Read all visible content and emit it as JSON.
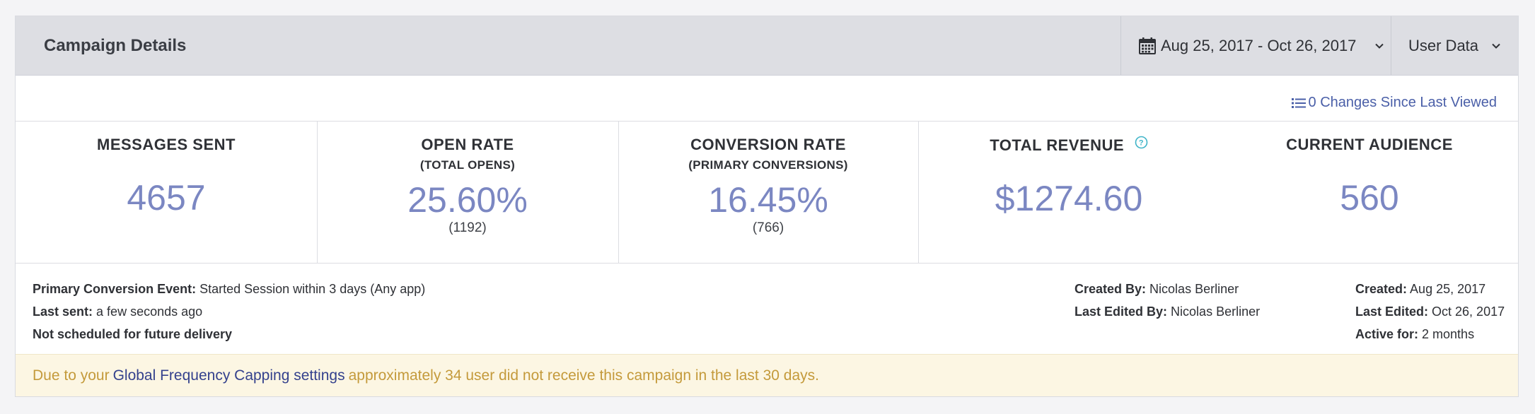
{
  "header": {
    "title": "Campaign Details",
    "date_range": "Aug 25, 2017 - Oct 26, 2017",
    "data_menu": "User Data"
  },
  "changes_link": "0 Changes Since Last Viewed",
  "stats": {
    "messages_sent": {
      "label": "MESSAGES SENT",
      "value": "4657"
    },
    "open_rate": {
      "label": "OPEN RATE",
      "sub": "(TOTAL OPENS)",
      "value": "25.60%",
      "count": "(1192)"
    },
    "conversion_rate": {
      "label": "CONVERSION RATE",
      "sub": "(PRIMARY CONVERSIONS)",
      "value": "16.45%",
      "count": "(766)"
    },
    "total_revenue": {
      "label": "TOTAL REVENUE",
      "value": "$1274.60"
    },
    "current_audience": {
      "label": "CURRENT AUDIENCE",
      "value": "560"
    }
  },
  "details": {
    "primary_conversion_label": "Primary Conversion Event:",
    "primary_conversion_value": "Started Session within 3 days (Any app)",
    "last_sent_label": "Last sent:",
    "last_sent_value": "a few seconds ago",
    "schedule_note": "Not scheduled for future delivery",
    "created_by_label": "Created By:",
    "created_by_value": "Nicolas Berliner",
    "last_edited_by_label": "Last Edited By:",
    "last_edited_by_value": "Nicolas Berliner",
    "created_label": "Created:",
    "created_value": "Aug 25, 2017",
    "last_edited_label": "Last Edited:",
    "last_edited_value": "Oct 26, 2017",
    "active_for_label": "Active for:",
    "active_for_value": "2 months"
  },
  "banner": {
    "prefix": "Due to your",
    "link": "Global Frequency Capping settings",
    "suffix": "approximately 34 user did not receive this campaign in the last 30 days."
  },
  "colors": {
    "accent_value": "#7b87c2",
    "link": "#4a5fa8",
    "banner_bg": "#fcf6e3",
    "banner_text": "#c49a3b",
    "header_bg": "#dddee3",
    "help_icon": "#3fb4c8"
  },
  "icons": {
    "calendar": "calendar-icon",
    "chevron": "chevron-down-icon",
    "list": "list-icon",
    "help": "help-circle-icon"
  }
}
